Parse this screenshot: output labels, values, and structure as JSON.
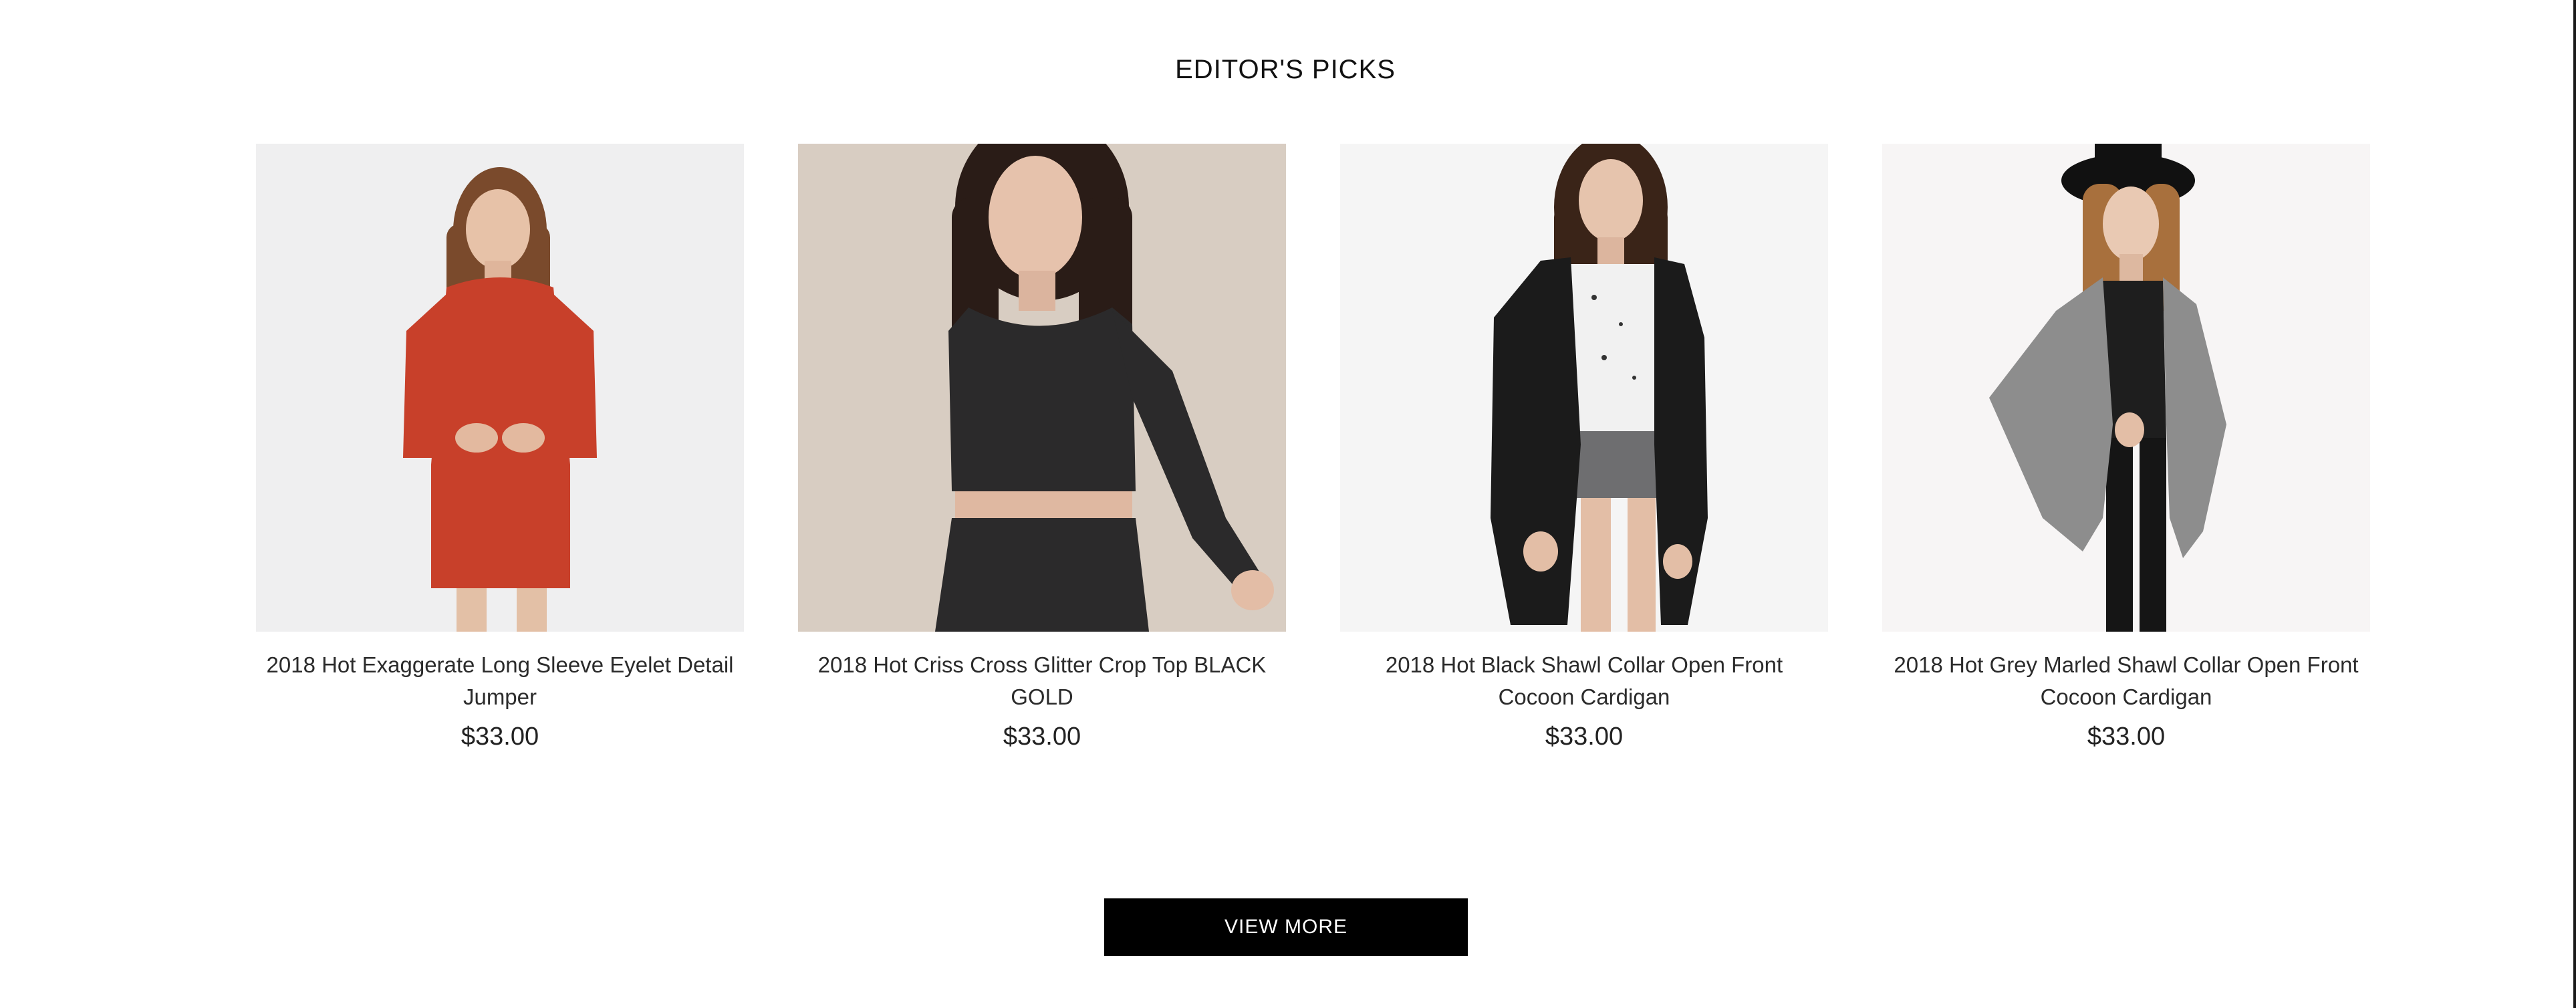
{
  "section": {
    "title": "EDITOR'S PICKS"
  },
  "products": [
    {
      "name": "2018 Hot Exaggerate Long Sleeve Eyelet Detail Jumper",
      "price": "$33.00",
      "bg": "#efeff0",
      "garment": "#c8402a",
      "hair": "#7a4a2c"
    },
    {
      "name": "2018 Hot Criss Cross Glitter Crop Top BLACK GOLD",
      "price": "$33.00",
      "bg": "#d8cdc2",
      "garment": "#2b2a2b",
      "hair": "#2a1c17"
    },
    {
      "name": "2018 Hot Black Shawl Collar Open Front Cocoon Cardigan",
      "price": "$33.00",
      "bg": "#f5f5f5",
      "garment": "#1b1b1b",
      "hair": "#3a2418"
    },
    {
      "name": "2018 Hot Grey Marled Shawl Collar Open Front Cocoon Cardigan",
      "price": "$33.00",
      "bg": "#f7f5f5",
      "garment": "#8d8d8d",
      "hair": "#a8703d"
    }
  ],
  "cta": {
    "view_more_label": "VIEW MORE"
  }
}
